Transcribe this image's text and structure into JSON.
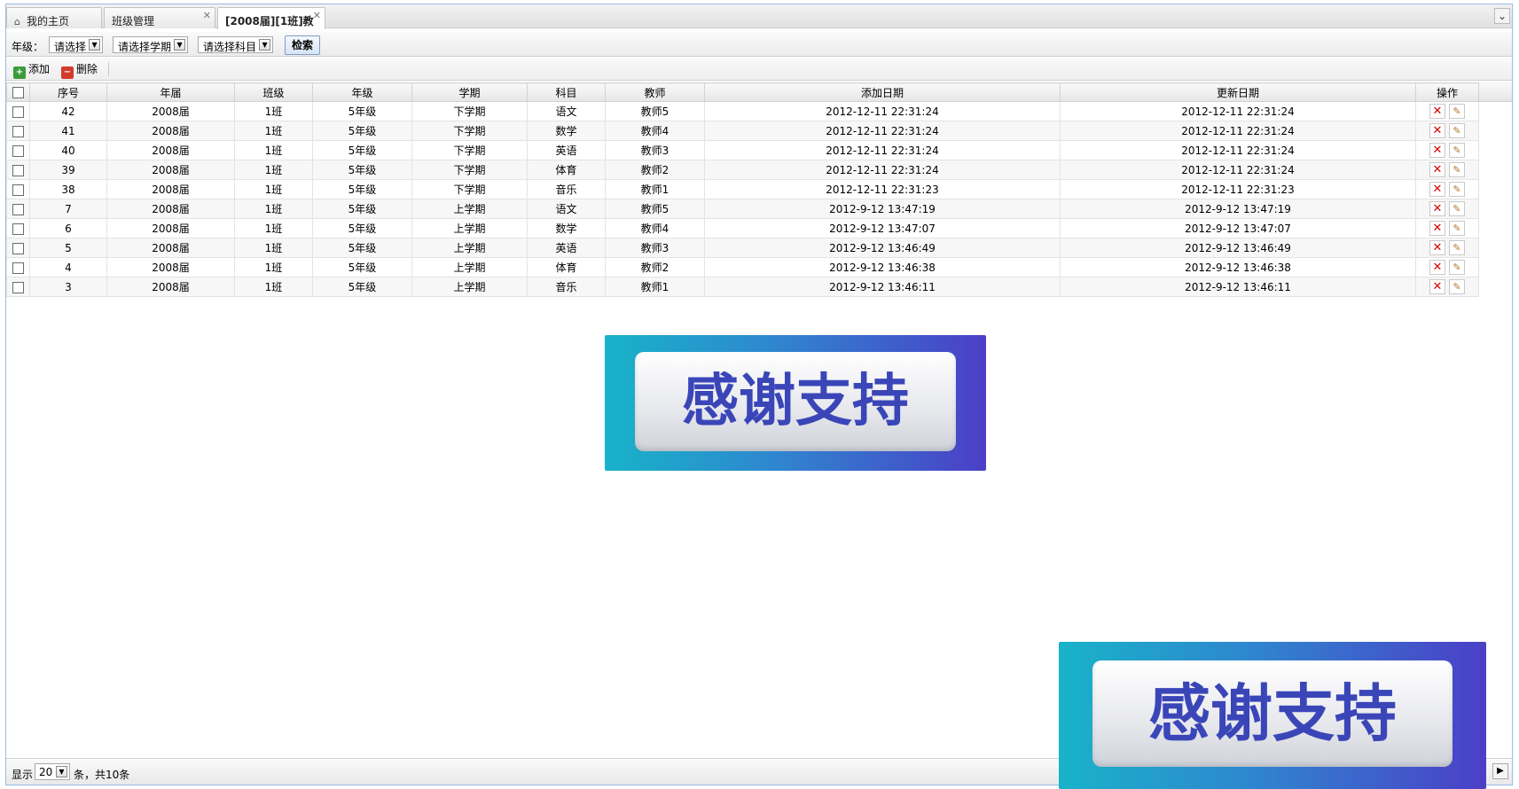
{
  "tabs": [
    {
      "label": "我的主页",
      "icon": "home-icon",
      "closable": false,
      "active": false
    },
    {
      "label": "班级管理",
      "closable": true,
      "active": false
    },
    {
      "label": "[2008届][1班]教",
      "closable": true,
      "active": true
    }
  ],
  "filter": {
    "grade_label": "年级：",
    "grade_select": "请选择",
    "term_select": "请选择学期",
    "subject_select": "请选择科目",
    "search_button": "检索"
  },
  "actions": {
    "add_label": "添加",
    "delete_label": "删除"
  },
  "table": {
    "headers": [
      "序号",
      "年届",
      "班级",
      "年级",
      "学期",
      "科目",
      "教师",
      "添加日期",
      "更新日期",
      "操作"
    ],
    "rows": [
      [
        "42",
        "2008届",
        "1班",
        "5年级",
        "下学期",
        "语文",
        "教师5",
        "2012-12-11 22:31:24",
        "2012-12-11 22:31:24"
      ],
      [
        "41",
        "2008届",
        "1班",
        "5年级",
        "下学期",
        "数学",
        "教师4",
        "2012-12-11 22:31:24",
        "2012-12-11 22:31:24"
      ],
      [
        "40",
        "2008届",
        "1班",
        "5年级",
        "下学期",
        "英语",
        "教师3",
        "2012-12-11 22:31:24",
        "2012-12-11 22:31:24"
      ],
      [
        "39",
        "2008届",
        "1班",
        "5年级",
        "下学期",
        "体育",
        "教师2",
        "2012-12-11 22:31:24",
        "2012-12-11 22:31:24"
      ],
      [
        "38",
        "2008届",
        "1班",
        "5年级",
        "下学期",
        "音乐",
        "教师1",
        "2012-12-11 22:31:23",
        "2012-12-11 22:31:23"
      ],
      [
        "7",
        "2008届",
        "1班",
        "5年级",
        "上学期",
        "语文",
        "教师5",
        "2012-9-12 13:47:19",
        "2012-9-12 13:47:19"
      ],
      [
        "6",
        "2008届",
        "1班",
        "5年级",
        "上学期",
        "数学",
        "教师4",
        "2012-9-12 13:47:07",
        "2012-9-12 13:47:07"
      ],
      [
        "5",
        "2008届",
        "1班",
        "5年级",
        "上学期",
        "英语",
        "教师3",
        "2012-9-12 13:46:49",
        "2012-9-12 13:46:49"
      ],
      [
        "4",
        "2008届",
        "1班",
        "5年级",
        "上学期",
        "体育",
        "教师2",
        "2012-9-12 13:46:38",
        "2012-9-12 13:46:38"
      ],
      [
        "3",
        "2008届",
        "1班",
        "5年级",
        "上学期",
        "音乐",
        "教师1",
        "2012-9-12 13:46:11",
        "2012-9-12 13:46:11"
      ]
    ]
  },
  "pager": {
    "show_label": "显示",
    "page_size": "20",
    "total_text": "条，共10条"
  },
  "banners": {
    "text": "感谢支持"
  },
  "colors": {
    "banner_start": "#18b3c9",
    "banner_end": "#4b3fc7",
    "banner_text": "#3a46b8",
    "delete_icon": "#d40000"
  }
}
